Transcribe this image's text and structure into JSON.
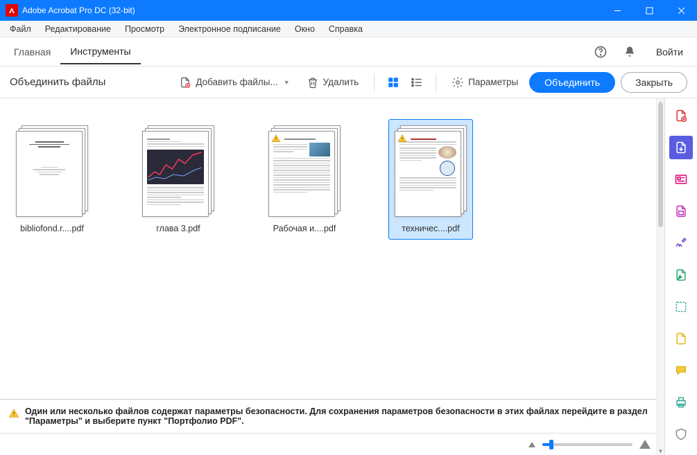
{
  "titlebar": {
    "title": "Adobe Acrobat Pro DC (32-bit)"
  },
  "menubar": [
    "Файл",
    "Редактирование",
    "Просмотр",
    "Электронное подписание",
    "Окно",
    "Справка"
  ],
  "tabs": {
    "home": "Главная",
    "tools": "Инструменты",
    "signin": "Войти"
  },
  "toolbar": {
    "title": "Объединить файлы",
    "add_files": "Добавить файлы...",
    "delete": "Удалить",
    "params": "Параметры",
    "combine": "Объединить",
    "close": "Закрыть"
  },
  "files": [
    {
      "name": "bibliofond.r....pdf",
      "multi": true,
      "warn": false,
      "selected": false,
      "kind": "text-title"
    },
    {
      "name": "глава 3.pdf",
      "multi": true,
      "warn": false,
      "selected": false,
      "kind": "chart"
    },
    {
      "name": "Рабочая и....pdf",
      "multi": true,
      "warn": true,
      "selected": false,
      "kind": "text-photo"
    },
    {
      "name": "техничес....pdf",
      "multi": true,
      "warn": true,
      "selected": true,
      "kind": "text-badge"
    }
  ],
  "warning": "Один или несколько файлов содержат параметры безопасности. Для сохранения параметров безопасности в этих файлах перейдите в раздел \"Параметры\" и выберите пункт \"Портфолио PDF\".",
  "rail_icons": [
    "create-pdf-icon",
    "export-pdf-icon",
    "edit-pdf-icon",
    "organize-icon",
    "sign-icon",
    "redact-icon",
    "protect-icon",
    "comment-icon",
    "print-icon",
    "shield-icon"
  ]
}
